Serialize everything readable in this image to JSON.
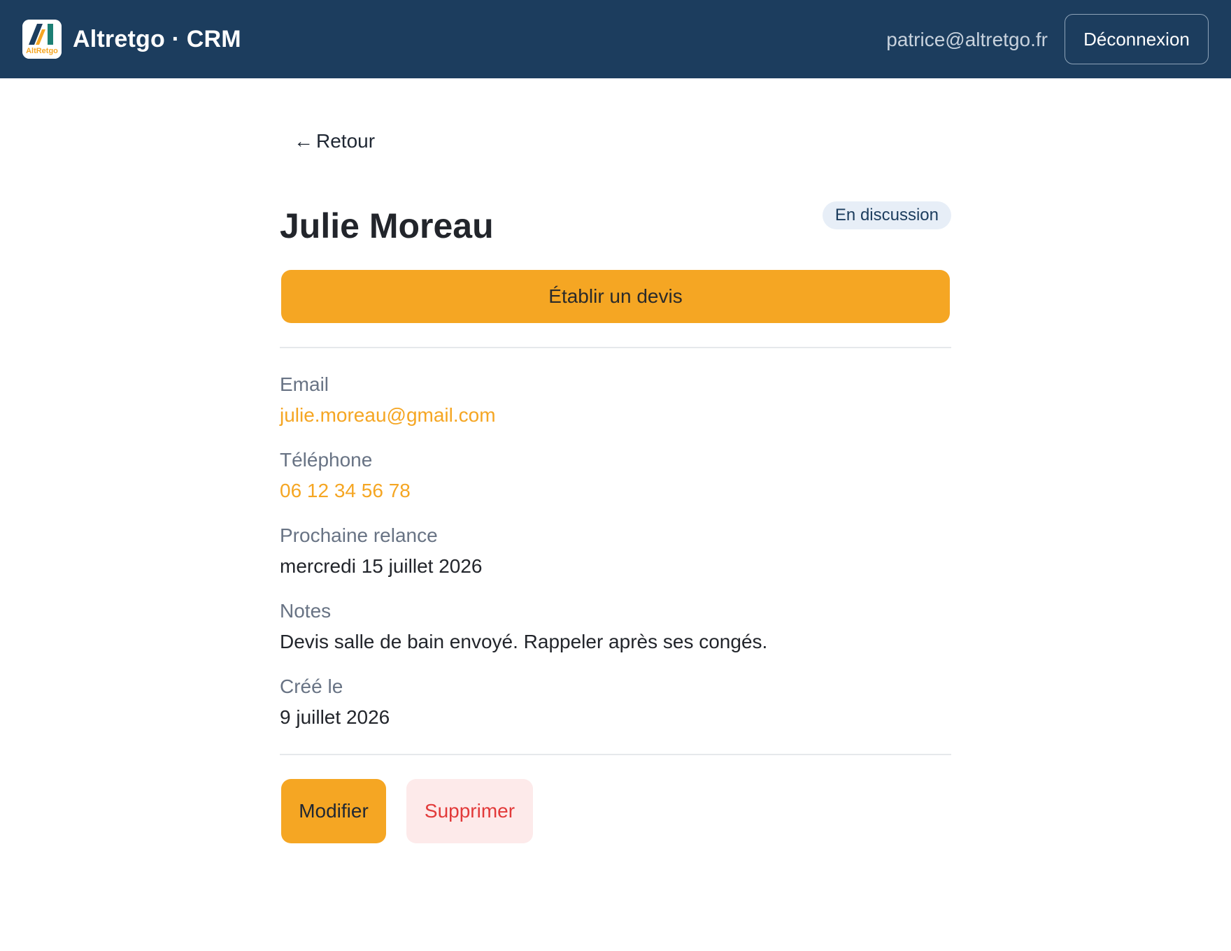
{
  "header": {
    "app_title": "Altretgo · CRM",
    "logo_icon": "altretgo-logo-icon",
    "logo_text": "AltRetgo",
    "user_email": "patrice@altretgo.fr",
    "logout_label": "Déconnexion"
  },
  "navigation": {
    "back_arrow": "←",
    "back_label": "Retour"
  },
  "contact": {
    "name": "Julie Moreau",
    "status": "En discussion",
    "create_quote_label": "Établir un devis",
    "fields": {
      "email": {
        "label": "Email",
        "value": "julie.moreau@gmail.com"
      },
      "phone": {
        "label": "Téléphone",
        "value": "06 12 34 56 78"
      },
      "next_followup": {
        "label": "Prochaine relance",
        "value": "mercredi 15 juillet 2026"
      },
      "notes": {
        "label": "Notes",
        "value": "Devis salle de bain envoyé. Rappeler après ses congés."
      },
      "created": {
        "label": "Créé le",
        "value": "9 juillet 2026"
      }
    }
  },
  "actions": {
    "edit_label": "Modifier",
    "delete_label": "Supprimer"
  },
  "colors": {
    "header_bg": "#1c3d5e",
    "accent": "#f5a623",
    "danger": "#e23a3a",
    "danger_bg": "#fdeaea",
    "badge_bg": "#e7eef7",
    "muted_label": "#687384"
  }
}
